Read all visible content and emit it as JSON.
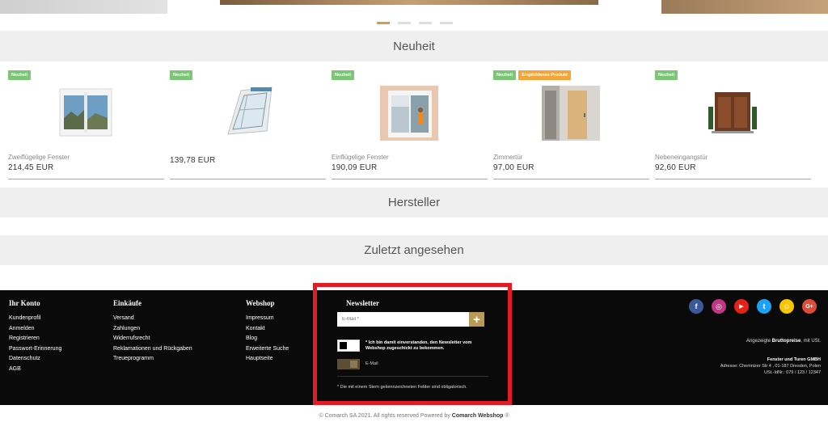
{
  "sections": {
    "new": "Neuheit",
    "manufacturer": "Hersteller",
    "recent": "Zuletzt angesehen"
  },
  "products": [
    {
      "badges": [
        "Neuheit"
      ],
      "name": "Zweiflügelige Fenster",
      "price": "214,45 EUR"
    },
    {
      "badges": [
        "Neuheit"
      ],
      "name": "",
      "price": "139,78 EUR"
    },
    {
      "badges": [
        "Neuheit"
      ],
      "name": "Einflügelige Fenster",
      "price": "190,09 EUR"
    },
    {
      "badges": [
        "Neuheit",
        "Empfohlenes Produkt"
      ],
      "name": "Zimmertür",
      "price": "97,00 EUR"
    },
    {
      "badges": [
        "Neuheit"
      ],
      "name": "Nebeneingangstür",
      "price": "92,60 EUR"
    }
  ],
  "footer": {
    "account": {
      "title": "Ihr Konto",
      "links": [
        "Kundenprofil",
        "Anmelden",
        "Registrieren",
        "Passwort-Erinnerung",
        "Datenschutz",
        "AGB"
      ]
    },
    "shopping": {
      "title": "Einkäufe",
      "links": [
        "Versand",
        "Zahlungen",
        "Widerrufsrecht",
        "Reklamationen und Rückgaben",
        "Treueprogramm"
      ]
    },
    "webshop": {
      "title": "Webshop",
      "links": [
        "Impressum",
        "Kontakt",
        "Blog",
        "Erweiterte Suche",
        "Hauptseite"
      ]
    },
    "newsletter": {
      "title": "Newsletter",
      "email_placeholder": "E-Mail *",
      "submit": "+",
      "consent": "* Ich bin damit einverstanden, den Newsletter vom Webshop zugeschickt zu bekommen.",
      "email_label": "E-Mail",
      "note": "* Die mit einem Stern gekennzeichneten Felder sind obligatorisch."
    },
    "social": [
      {
        "icon": "facebook-icon",
        "glyph": "f",
        "color": "#3b5998"
      },
      {
        "icon": "instagram-icon",
        "glyph": "◎",
        "color": "#c13584"
      },
      {
        "icon": "youtube-icon",
        "glyph": "▶",
        "color": "#e62117"
      },
      {
        "icon": "twitter-icon",
        "glyph": "t",
        "color": "#1da1f2"
      },
      {
        "icon": "snapchat-icon",
        "glyph": "☺",
        "color": "#f6c700"
      },
      {
        "icon": "google-plus-icon",
        "glyph": "G+",
        "color": "#dd4b39"
      }
    ],
    "price_note_prefix": "Angezeigte ",
    "price_note_bold": "Bruttopreise",
    "price_note_suffix": ", mit USt.",
    "company_name": "Fenster und Turen GMBH",
    "company_address": "Adresse: Chemnizer Str 4 , 01-187 Dresden, Polen",
    "company_vat": "USt.-IdNr.: 079 / 123 / 12347"
  },
  "copyright_prefix": "© Comarch SA 2021. All rights reserved Powered by ",
  "copyright_brand": "Comarch Webshop",
  "copyright_suffix": " ®"
}
